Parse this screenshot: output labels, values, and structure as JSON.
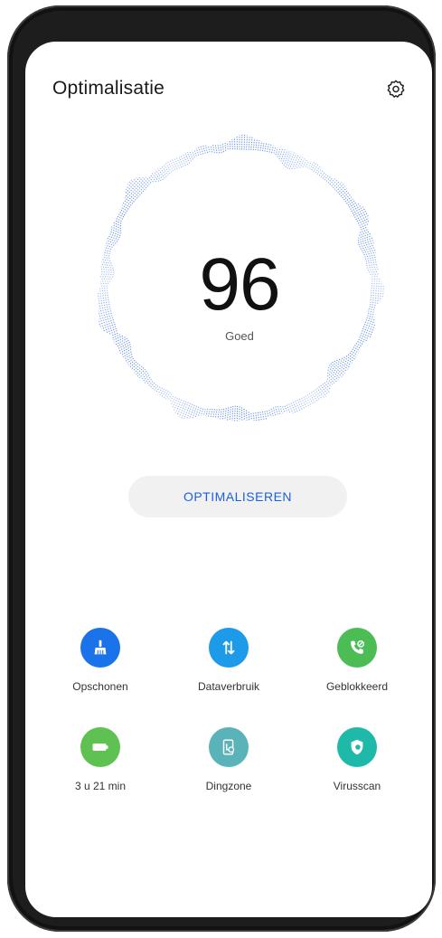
{
  "header": {
    "title": "Optimalisatie",
    "settings_icon": "settings-gear-icon"
  },
  "score": {
    "value": "96",
    "label": "Goed",
    "dial_color": "#4a7ee8"
  },
  "optimize_button": {
    "label": "OPTIMALISEREN",
    "color": "#1e5fe0"
  },
  "tools": [
    {
      "label": "Opschonen",
      "icon": "broom-icon",
      "color": "#1a73e8"
    },
    {
      "label": "Dataverbruik",
      "icon": "data-arrows-icon",
      "color": "#1e9be8"
    },
    {
      "label": "Geblokkeerd",
      "icon": "phone-block-icon",
      "color": "#4cbd55"
    },
    {
      "label": "3 u 21 min",
      "icon": "battery-icon",
      "color": "#5fc152"
    },
    {
      "label": "Dingzone",
      "icon": "hourglass-phone-icon",
      "color": "#5ab3b8"
    },
    {
      "label": "Virusscan",
      "icon": "shield-scan-icon",
      "color": "#1fb9a9"
    }
  ]
}
